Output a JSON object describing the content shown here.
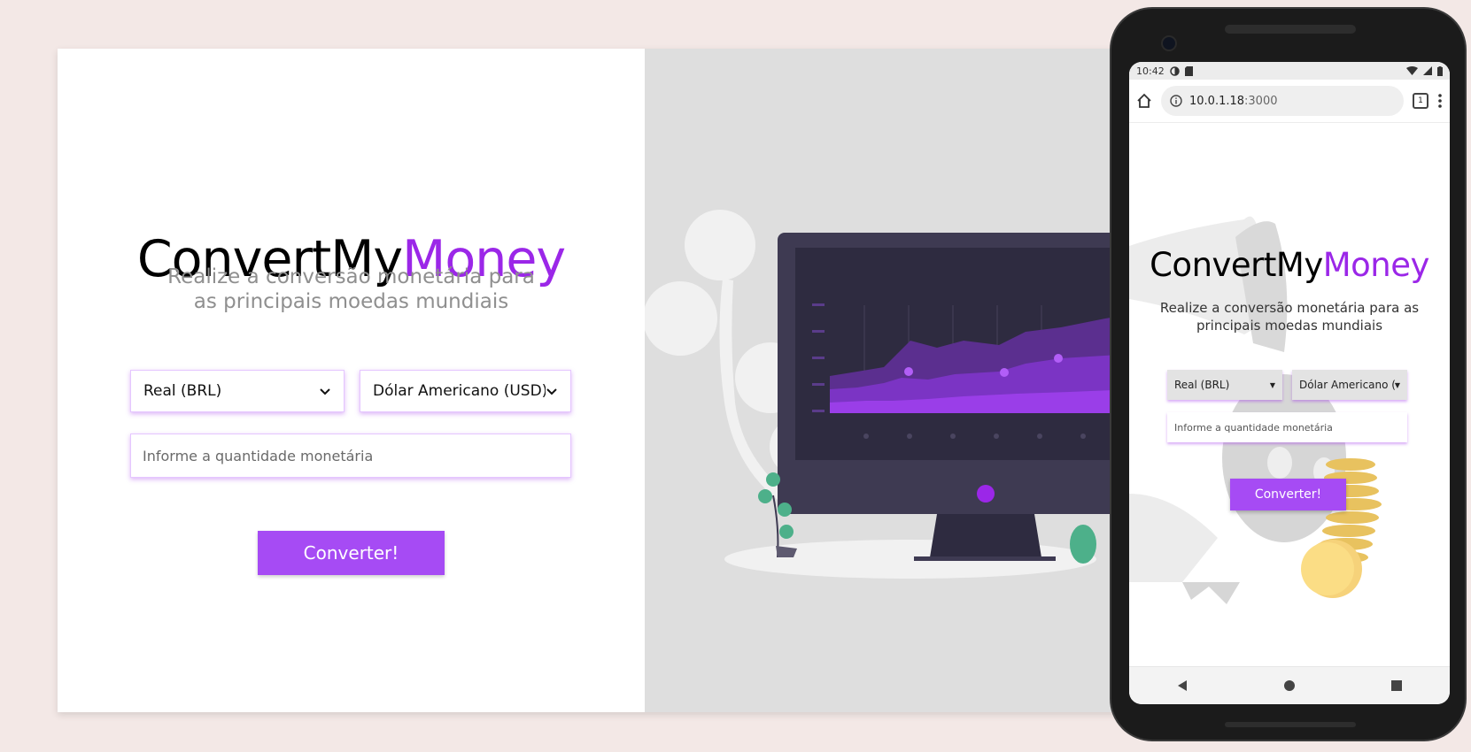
{
  "desktop": {
    "logo_main": "ConvertMy",
    "logo_accent": "Money",
    "subtitle": "Realize a conversão monetária para as principais moedas mundiais",
    "from_currency": "Real (BRL)",
    "to_currency": "Dólar Americano (USD)",
    "amount_placeholder": "Informe a quantidade monetária",
    "convert_label": "Converter!"
  },
  "phone": {
    "status_time": "10:42",
    "url_host": "10.0.1.18",
    "url_port": ":3000",
    "tab_count": "1",
    "logo_main": "ConvertMy",
    "logo_accent": "Money",
    "subtitle": "Realize a conversão monetária para as principais moedas mundiais",
    "from_currency": "Real (BRL)",
    "to_currency": "Dólar Americano (",
    "amount_placeholder": "Informe a quantidade monetária",
    "convert_label": "Converter!"
  },
  "colors": {
    "accent": "#9b27e8",
    "button": "#a64bf4",
    "background": "#f3e8e6",
    "illustration_bg": "#dedede"
  }
}
